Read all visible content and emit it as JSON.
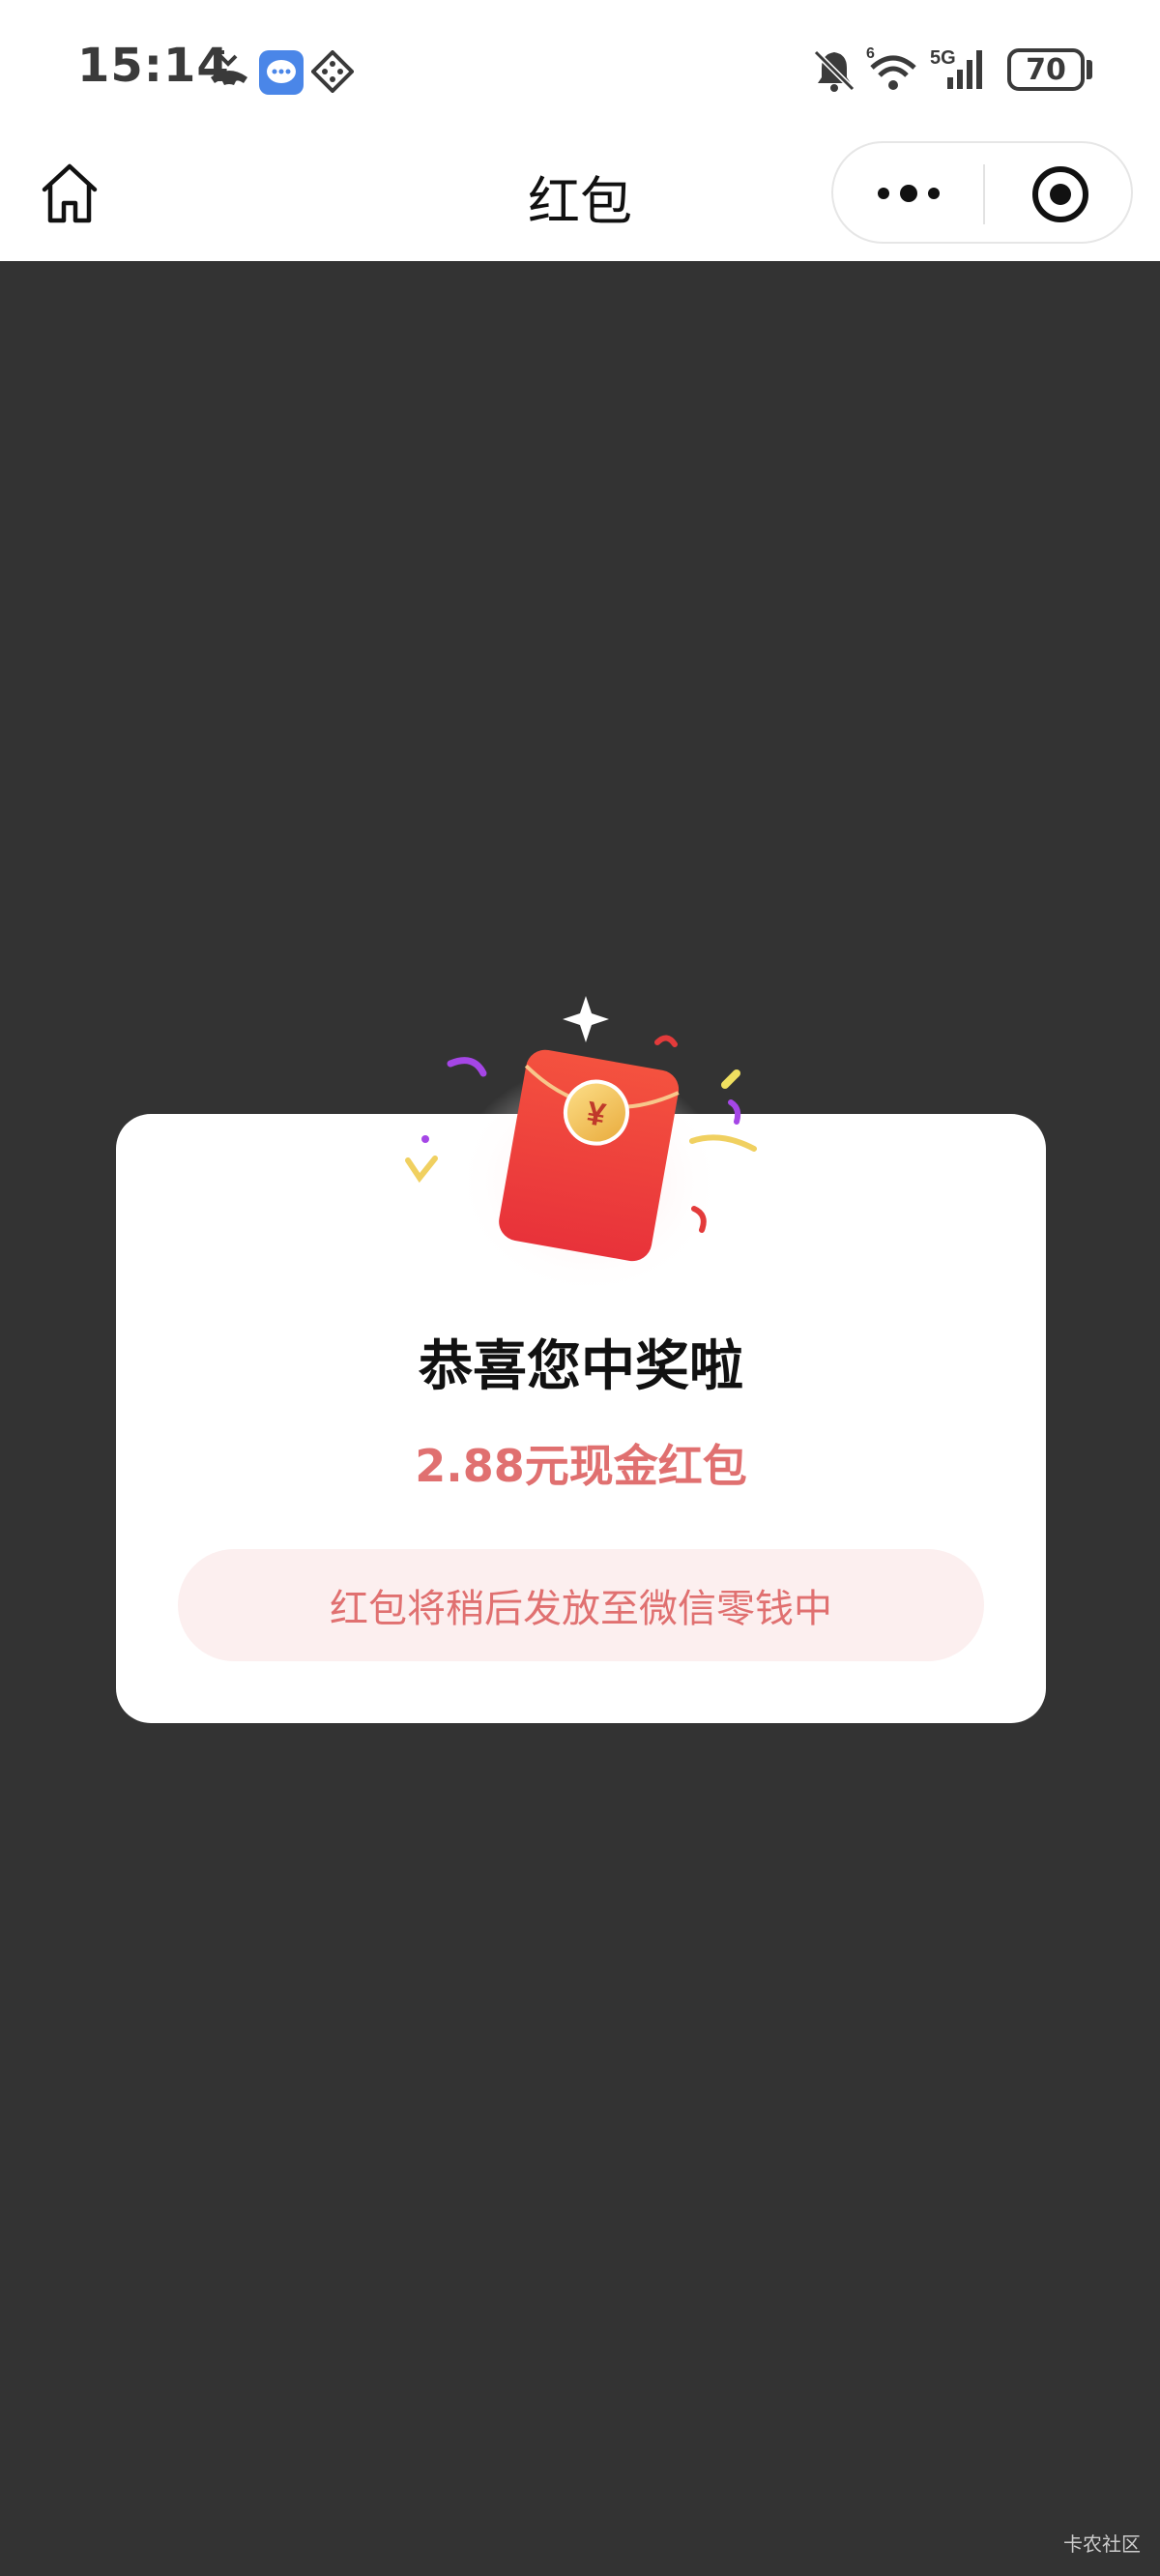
{
  "status_bar": {
    "time": "15:14",
    "icons": [
      "missed-call-icon",
      "message-app-icon",
      "app-grid-icon",
      "mute-bell-icon",
      "wifi-icon",
      "5g-signal-icon"
    ],
    "battery": "70"
  },
  "nav": {
    "title": "红包",
    "icons": [
      "home-icon",
      "more-dots-icon",
      "close-target-icon"
    ]
  },
  "card": {
    "title": "恭喜您中奖啦",
    "amount": "2.88元现金红包",
    "notice": "红包将稍后发放至微信零钱中"
  },
  "watermark": "卡农社区",
  "colors": {
    "background": "#333333",
    "accent": "#e07070",
    "pill_bg": "#fcefef",
    "envelope": "#e83a3a",
    "coin": "#f5c54a"
  }
}
